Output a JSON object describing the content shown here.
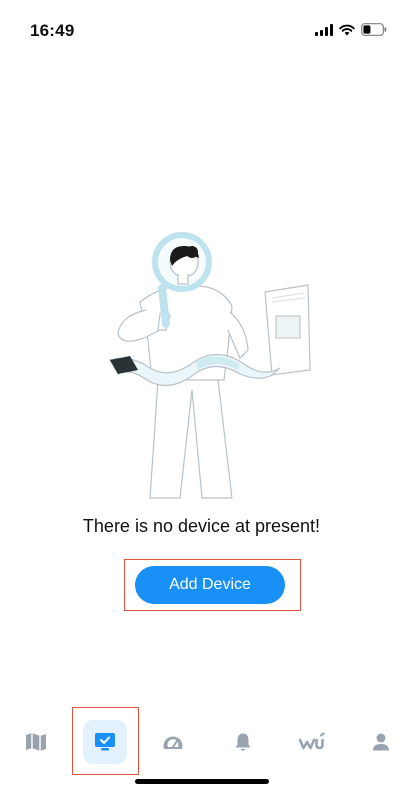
{
  "status_bar": {
    "time": "16:49",
    "icons": [
      "signal-icon",
      "wifi-icon",
      "battery-icon"
    ]
  },
  "empty_state": {
    "message": "There is no device at present!",
    "illustration": "person-with-magnifier-illustration"
  },
  "actions": {
    "add_device_label": "Add Device"
  },
  "tab_bar": {
    "items": [
      {
        "icon": "map-icon",
        "active": false
      },
      {
        "icon": "device-monitor-icon",
        "active": true
      },
      {
        "icon": "gauge-icon",
        "active": false
      },
      {
        "icon": "bell-icon",
        "active": false
      },
      {
        "icon": "wu-logo-icon",
        "active": false
      },
      {
        "icon": "profile-icon",
        "active": false
      }
    ]
  },
  "colors": {
    "accent": "#1890f5",
    "highlight": "#e0533f",
    "tab_inactive": "#9aa4ae",
    "tab_active_bg": "#e3f1fd"
  }
}
